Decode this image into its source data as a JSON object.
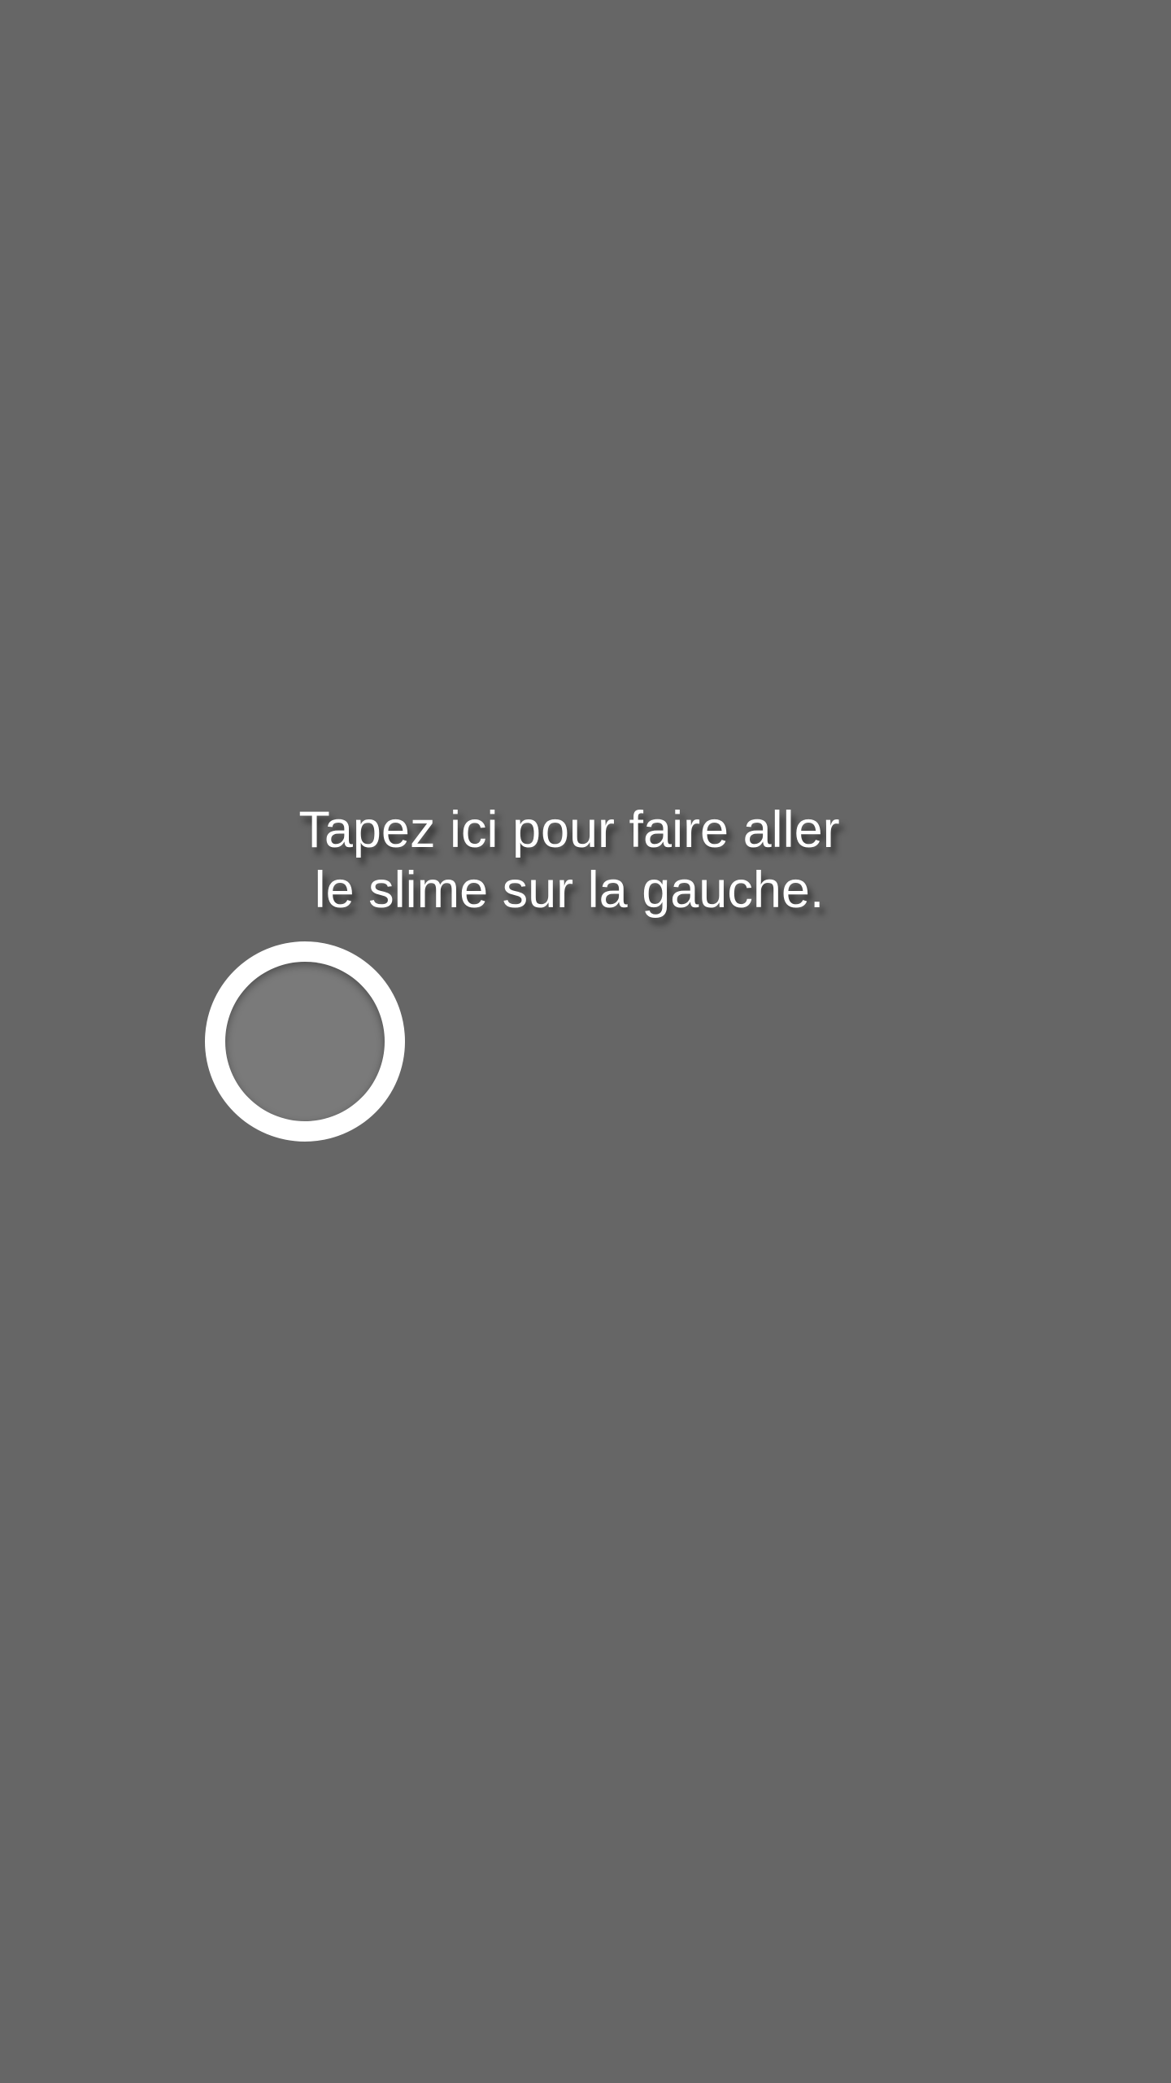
{
  "tutorial": {
    "line1": "Tapez ici pour faire aller",
    "line2": "le slime sur la gauche.",
    "target_icon": "tap-circle-icon"
  },
  "colors": {
    "background": "#666666",
    "text": "#ffffff",
    "ring": "#ffffff",
    "ring_inner": "#7a7a7a"
  }
}
